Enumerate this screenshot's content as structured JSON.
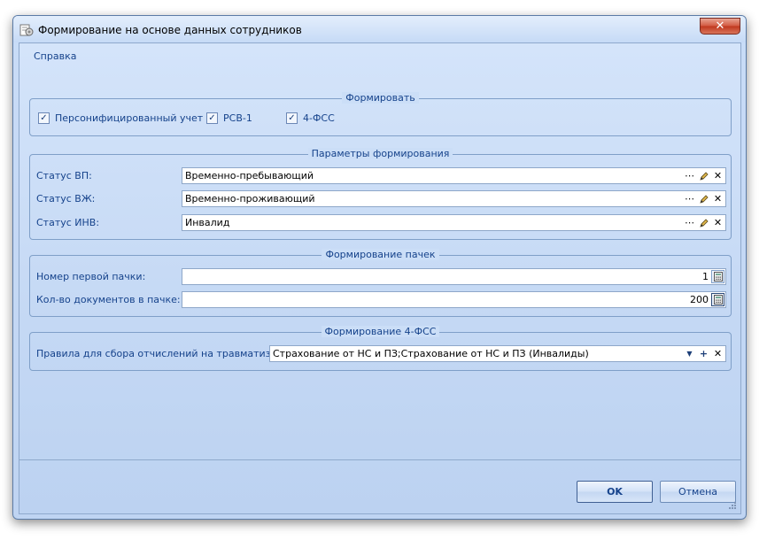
{
  "window": {
    "title": "Формирование на основе данных сотрудников",
    "close_symbol": "✕"
  },
  "menu": {
    "help": "Справка"
  },
  "form_group": {
    "title": "Формировать",
    "checkboxes": [
      {
        "label": "Персонифицированный учет",
        "checked": true
      },
      {
        "label": "РСВ-1",
        "checked": true
      },
      {
        "label": "4-ФСС",
        "checked": true
      }
    ]
  },
  "params_group": {
    "title": "Параметры формирования",
    "rows": [
      {
        "label": "Статус ВП:",
        "value": "Временно-пребывающий"
      },
      {
        "label": "Статус ВЖ:",
        "value": "Временно-проживающий"
      },
      {
        "label": "Статус ИНВ:",
        "value": "Инвалид"
      }
    ]
  },
  "packs_group": {
    "title": "Формирование пачек",
    "first_pack_label": "Номер первой пачки:",
    "first_pack_value": "1",
    "docs_per_pack_label": "Кол-во документов в пачке:",
    "docs_per_pack_value": "200"
  },
  "fss_group": {
    "title": "Формирование 4-ФСС",
    "rules_label": "Правила для сбора отчислений на травматизм:",
    "rules_value": "Страхование от НС и ПЗ;Страхование от НС и ПЗ (Инвалиды)"
  },
  "buttons": {
    "ok": "OK",
    "cancel": "Отмена"
  },
  "icons": {
    "ellipsis": "⋯",
    "clear": "✕",
    "dropdown": "▼",
    "plus": "+",
    "check": "✓"
  }
}
